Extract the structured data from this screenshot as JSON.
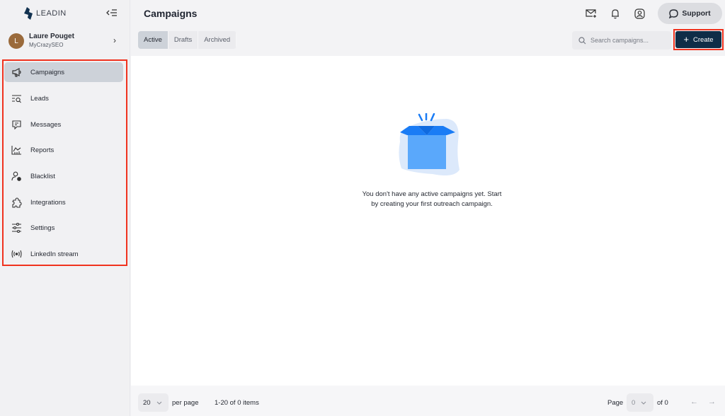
{
  "app": {
    "brand": "LEADIN"
  },
  "user": {
    "initial": "L",
    "name": "Laure Pouget",
    "org": "MyCrazySEO"
  },
  "sidebar": {
    "items": [
      {
        "label": "Campaigns",
        "icon": "megaphone-icon",
        "active": true
      },
      {
        "label": "Leads",
        "icon": "list-search-icon"
      },
      {
        "label": "Messages",
        "icon": "message-icon"
      },
      {
        "label": "Reports",
        "icon": "chart-icon"
      },
      {
        "label": "Blacklist",
        "icon": "user-block-icon"
      },
      {
        "label": "Integrations",
        "icon": "puzzle-icon"
      },
      {
        "label": "Settings",
        "icon": "sliders-icon"
      },
      {
        "label": "LinkedIn stream",
        "icon": "broadcast-icon"
      }
    ]
  },
  "header": {
    "title": "Campaigns",
    "support_label": "Support"
  },
  "tabs": [
    {
      "label": "Active",
      "active": true
    },
    {
      "label": "Drafts"
    },
    {
      "label": "Archived"
    }
  ],
  "search": {
    "placeholder": "Search campaigns..."
  },
  "toolbar": {
    "create_label": "Create"
  },
  "empty_state": {
    "line1": "You don't have any active campaigns yet. Start",
    "line2": "by creating your first outreach campaign."
  },
  "pagination": {
    "per_page_value": "20",
    "per_page_label": "per page",
    "items_summary": "1-20 of 0 items",
    "page_label": "Page",
    "page_value": "0",
    "of_label": "of 0"
  },
  "colors": {
    "accent_dark": "#0f2d47",
    "highlight_box": "#f0321e",
    "active_nav": "#cdd2d9",
    "illustration_blue": "#1a7cf5"
  }
}
